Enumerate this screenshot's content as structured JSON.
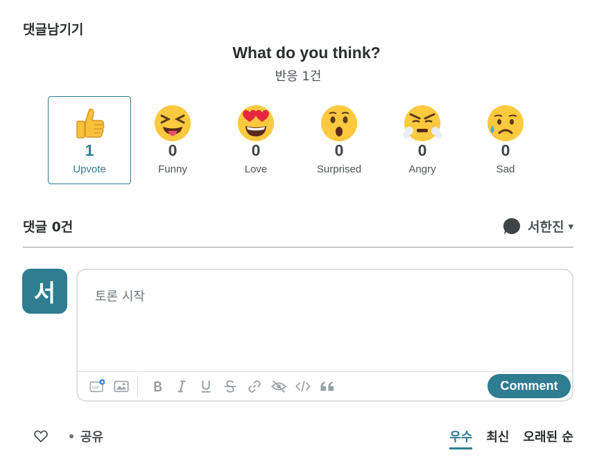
{
  "section_title": "댓글남기기",
  "reactions_block": {
    "question": "What do you think?",
    "count_text": "반응 1건",
    "items": [
      {
        "label": "Upvote",
        "count": "1",
        "icon": "thumbs-up-icon"
      },
      {
        "label": "Funny",
        "count": "0",
        "icon": "funny-face-icon"
      },
      {
        "label": "Love",
        "count": "0",
        "icon": "heart-eyes-icon"
      },
      {
        "label": "Surprised",
        "count": "0",
        "icon": "surprised-face-icon"
      },
      {
        "label": "Angry",
        "count": "0",
        "icon": "angry-face-icon"
      },
      {
        "label": "Sad",
        "count": "0",
        "icon": "sad-face-icon"
      }
    ]
  },
  "comments": {
    "count_text": "댓글 0건",
    "user_name": "서한진",
    "caret": "▾",
    "avatar_letter": "서",
    "placeholder": "토론 시작",
    "submit_label": "Comment"
  },
  "toolbar": [
    "gif-icon",
    "image-icon",
    "bold-icon",
    "italic-icon",
    "underline-icon",
    "strikethrough-icon",
    "link-icon",
    "spoiler-icon",
    "code-icon",
    "quote-icon"
  ],
  "footer": {
    "share_label": "공유",
    "sort_options": [
      "우수",
      "최신",
      "오래된 순"
    ],
    "active_sort": "우수"
  },
  "colors": {
    "accent": "#2e7d90",
    "text": "#2a2e2e",
    "muted": "#9aa1a4"
  }
}
